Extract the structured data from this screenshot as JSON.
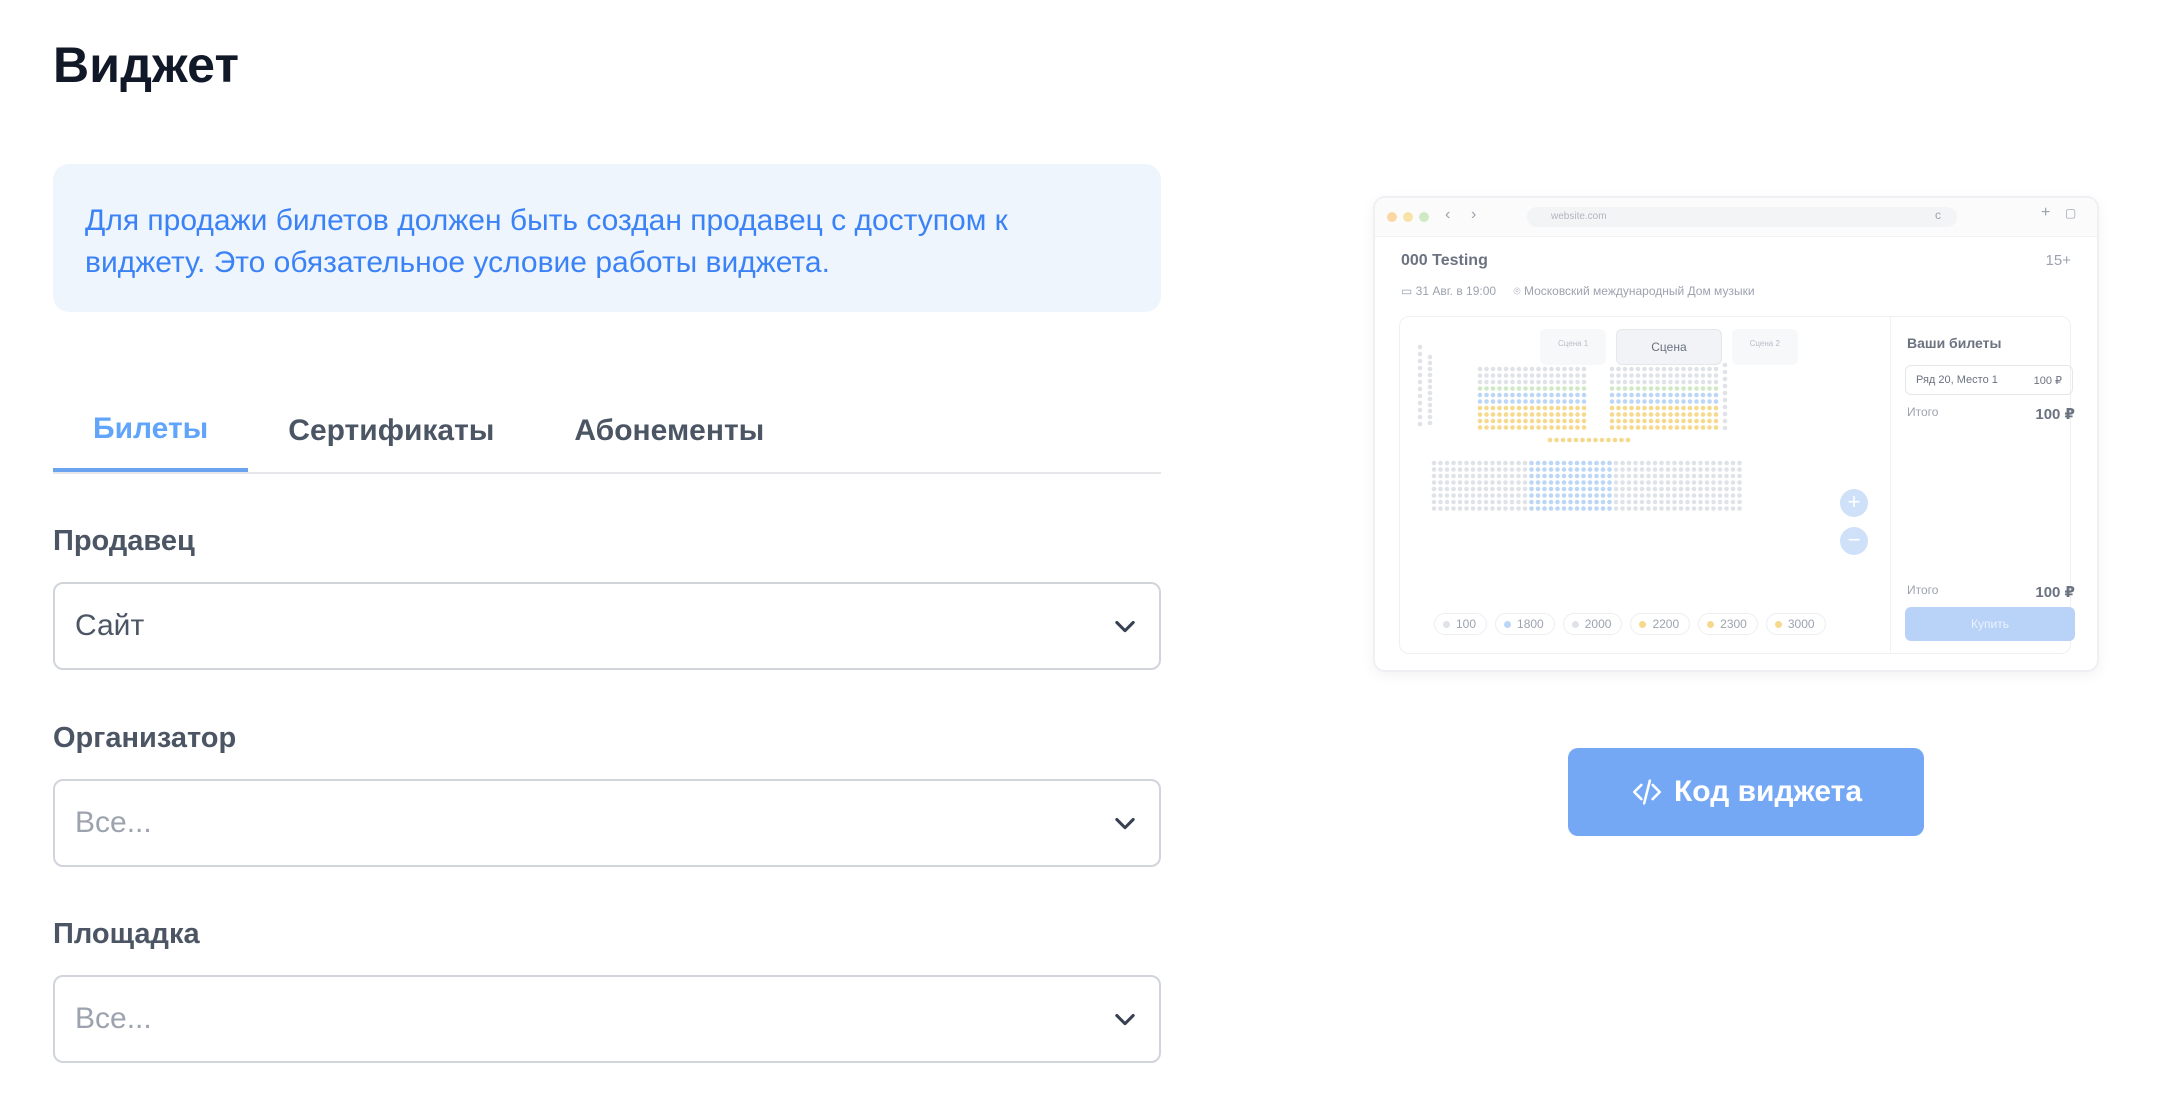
{
  "page": {
    "title": "Виджет"
  },
  "info": {
    "text": "Для продажи билетов должен быть создан продавец с доступом к виджету. Это обязательное условие работы виджета."
  },
  "tabs": [
    {
      "label": "Билеты",
      "active": true
    },
    {
      "label": "Сертификаты",
      "active": false
    },
    {
      "label": "Абонементы",
      "active": false
    }
  ],
  "fields": {
    "seller": {
      "label": "Продавец",
      "value": "Сайт"
    },
    "organizer": {
      "label": "Организатор",
      "placeholder": "Все..."
    },
    "venue": {
      "label": "Площадка",
      "placeholder": "Все..."
    }
  },
  "preview": {
    "url": "website.com",
    "event": "000 Testing",
    "age": "15+",
    "date": "31 Авг. в 19:00",
    "place": "Московский международный Дом музыки",
    "tabs": [
      "Сцена 1",
      "Сцена",
      "Сцена 2"
    ],
    "your_tickets": "Ваши билеты",
    "ticket": {
      "seat": "Ряд 20, Место 1",
      "price": "100 ₽"
    },
    "subtotal": {
      "label": "Итого",
      "value": "100 ₽"
    },
    "total": {
      "label": "Итого",
      "value": "100 ₽"
    },
    "buy": "Купить",
    "prices": [
      "100",
      "1800",
      "2000",
      "2200",
      "2300",
      "3000"
    ],
    "colors": {
      "blue": "#bcd6f5",
      "green": "#cfe9c4",
      "yellow": "#f6d98d",
      "gray": "#dfe3e8"
    }
  },
  "actions": {
    "widget_code": "Код виджета"
  }
}
